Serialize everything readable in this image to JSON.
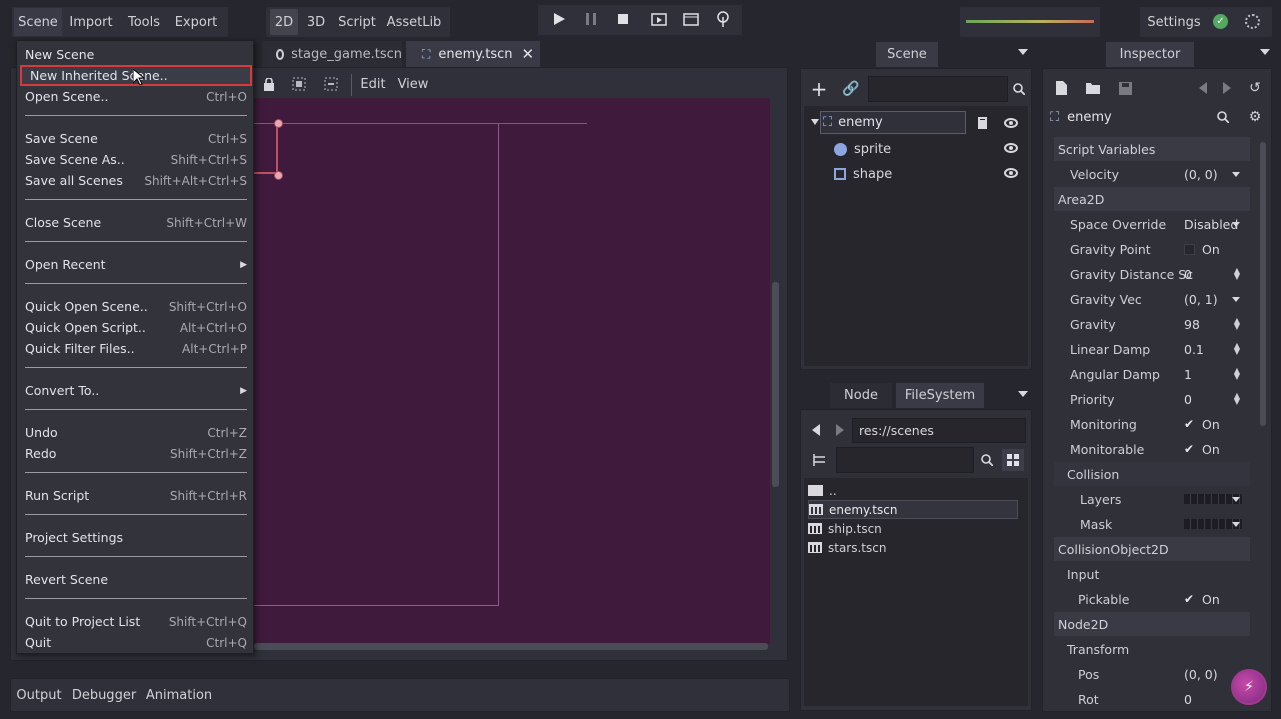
{
  "menubar": {
    "scene": "Scene",
    "import": "Import",
    "tools": "Tools",
    "export": "Export"
  },
  "modes": {
    "d2": "2D",
    "d3": "3D",
    "script": "Script",
    "assetlib": "AssetLib"
  },
  "settings": {
    "label": "Settings"
  },
  "tabs": [
    {
      "label": "stage_game.tscn"
    },
    {
      "label": "enemy.tscn"
    }
  ],
  "viewport_toolbar": {
    "edit": "Edit",
    "view": "View"
  },
  "scene_menu": {
    "items": [
      {
        "label": "New Scene",
        "shortcut": ""
      },
      {
        "label": "New Inherited Scene..",
        "shortcut": ""
      },
      {
        "label": "Open Scene..",
        "shortcut": "Ctrl+O"
      },
      {
        "label": "Save Scene",
        "shortcut": "Ctrl+S"
      },
      {
        "label": "Save Scene As..",
        "shortcut": "Shift+Ctrl+S"
      },
      {
        "label": "Save all Scenes",
        "shortcut": "Shift+Alt+Ctrl+S"
      },
      {
        "label": "Close Scene",
        "shortcut": "Shift+Ctrl+W"
      },
      {
        "label": "Open Recent",
        "shortcut": ""
      },
      {
        "label": "Quick Open Scene..",
        "shortcut": "Shift+Ctrl+O"
      },
      {
        "label": "Quick Open Script..",
        "shortcut": "Alt+Ctrl+O"
      },
      {
        "label": "Quick Filter Files..",
        "shortcut": "Alt+Ctrl+P"
      },
      {
        "label": "Convert To..",
        "shortcut": ""
      },
      {
        "label": "Undo",
        "shortcut": "Ctrl+Z"
      },
      {
        "label": "Redo",
        "shortcut": "Shift+Ctrl+Z"
      },
      {
        "label": "Run Script",
        "shortcut": "Shift+Ctrl+R"
      },
      {
        "label": "Project Settings",
        "shortcut": ""
      },
      {
        "label": "Revert Scene",
        "shortcut": ""
      },
      {
        "label": "Quit to Project List",
        "shortcut": "Shift+Ctrl+Q"
      },
      {
        "label": "Quit",
        "shortcut": "Ctrl+Q"
      }
    ]
  },
  "scene_dock": {
    "tab": "Scene",
    "nodes": [
      {
        "name": "enemy"
      },
      {
        "name": "sprite"
      },
      {
        "name": "shape"
      }
    ]
  },
  "fs_dock": {
    "tab_node": "Node",
    "tab_fs": "FileSystem",
    "path": "res://scenes",
    "files": [
      {
        "name": ".."
      },
      {
        "name": "enemy.tscn"
      },
      {
        "name": "ship.tscn"
      },
      {
        "name": "stars.tscn"
      }
    ]
  },
  "inspector": {
    "tab": "Inspector",
    "object": "enemy",
    "cat_script": "Script Variables",
    "velocity_label": "Velocity",
    "velocity_val": "(0, 0)",
    "cat_area": "Area2D",
    "space_label": "Space Override",
    "space_val": "Disabled",
    "gpoint_label": "Gravity Point",
    "gpoint_val": "On",
    "gdist_label": "Gravity Distance Sc",
    "gdist_val": "0",
    "gvec_label": "Gravity Vec",
    "gvec_val": "(0, 1)",
    "gravity_label": "Gravity",
    "gravity_val": "98",
    "ldamp_label": "Linear Damp",
    "ldamp_val": "0.1",
    "adamp_label": "Angular Damp",
    "adamp_val": "1",
    "priority_label": "Priority",
    "priority_val": "0",
    "monitoring_label": "Monitoring",
    "monitoring_val": "On",
    "monitorable_label": "Monitorable",
    "monitorable_val": "On",
    "collision_label": "Collision",
    "layers_label": "Layers",
    "mask_label": "Mask",
    "cat_collision": "CollisionObject2D",
    "input_label": "Input",
    "pickable_label": "Pickable",
    "pickable_val": "On",
    "cat_node2d": "Node2D",
    "transform_label": "Transform",
    "pos_label": "Pos",
    "pos_val": "(0, 0)",
    "rot_label": "Rot",
    "rot_val": "0"
  },
  "bottom": {
    "output": "Output",
    "debugger": "Debugger",
    "animation": "Animation"
  }
}
